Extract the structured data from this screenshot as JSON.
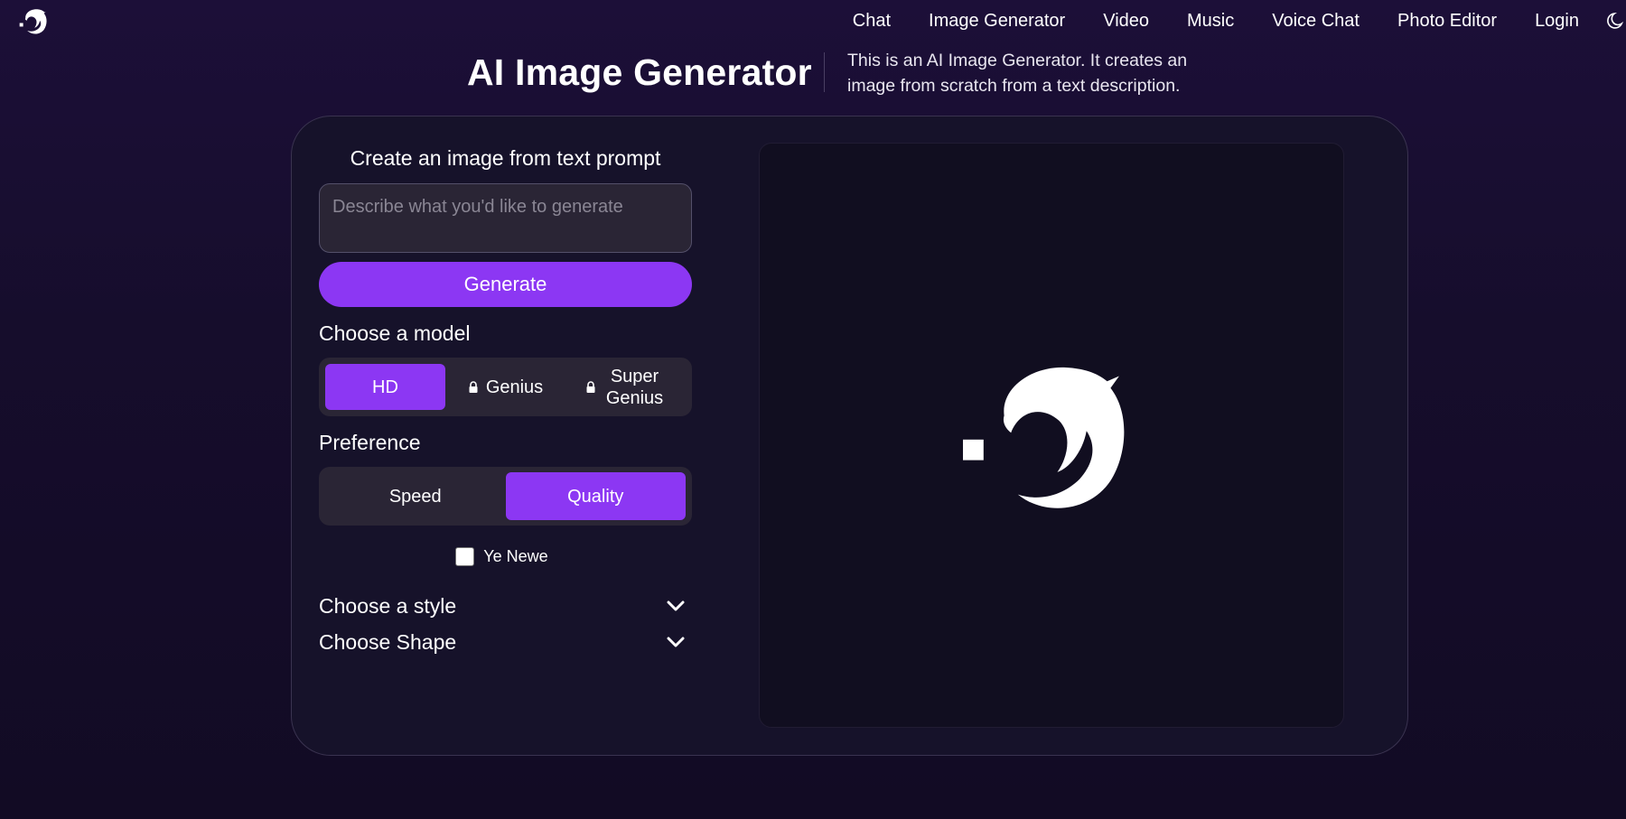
{
  "nav": {
    "links": [
      "Chat",
      "Image Generator",
      "Video",
      "Music",
      "Voice Chat",
      "Photo Editor",
      "Login"
    ],
    "logo_icon": "dolphin-logo-icon",
    "theme_icon": "moon-icon"
  },
  "header": {
    "title": "AI Image Generator",
    "subtitle": "This is an AI Image Generator. It creates an image from scratch from a text description."
  },
  "form": {
    "panel_title": "Create an image from text prompt",
    "prompt_placeholder": "Describe what you'd like to generate",
    "prompt_value": "",
    "generate_label": "Generate",
    "model_label": "Choose a model",
    "models": [
      {
        "label": "HD",
        "active": true,
        "locked": false
      },
      {
        "label": "Genius",
        "active": false,
        "locked": true
      },
      {
        "label": "Super Genius",
        "active": false,
        "locked": true
      }
    ],
    "preference_label": "Preference",
    "preferences": [
      {
        "label": "Speed",
        "active": false
      },
      {
        "label": "Quality",
        "active": true
      }
    ],
    "checkbox_label": "Ye Newe",
    "checkbox_checked": false,
    "style_label": "Choose a style",
    "shape_label": "Choose Shape"
  },
  "preview": {
    "placeholder_icon": "dolphin-logo-icon"
  },
  "colors": {
    "accent": "#8c37f3",
    "background": "#160d2c",
    "card": "#16122a",
    "preview": "#110e20",
    "input": "#2a2535"
  }
}
